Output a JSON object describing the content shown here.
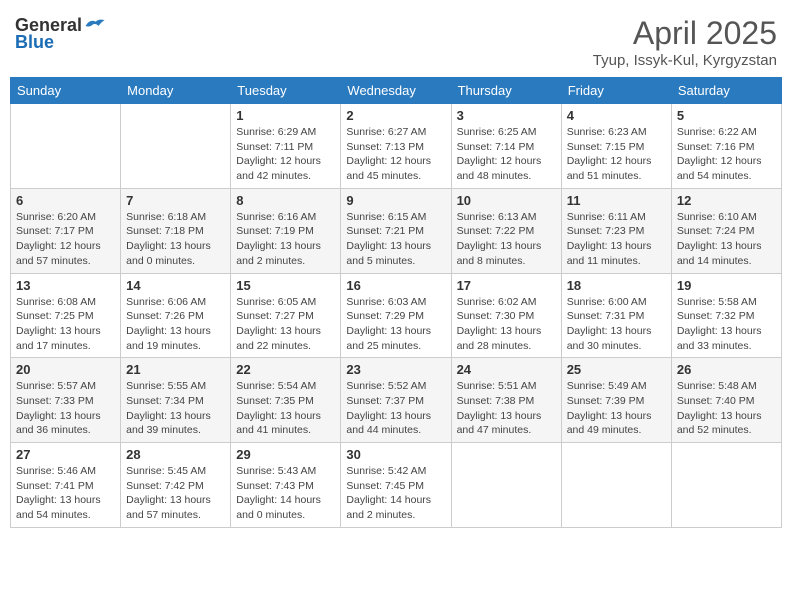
{
  "header": {
    "logo_general": "General",
    "logo_blue": "Blue",
    "title": "April 2025",
    "location": "Tyup, Issyk-Kul, Kyrgyzstan"
  },
  "weekdays": [
    "Sunday",
    "Monday",
    "Tuesday",
    "Wednesday",
    "Thursday",
    "Friday",
    "Saturday"
  ],
  "weeks": [
    [
      {
        "day": "",
        "info": ""
      },
      {
        "day": "",
        "info": ""
      },
      {
        "day": "1",
        "info": "Sunrise: 6:29 AM\nSunset: 7:11 PM\nDaylight: 12 hours\nand 42 minutes."
      },
      {
        "day": "2",
        "info": "Sunrise: 6:27 AM\nSunset: 7:13 PM\nDaylight: 12 hours\nand 45 minutes."
      },
      {
        "day": "3",
        "info": "Sunrise: 6:25 AM\nSunset: 7:14 PM\nDaylight: 12 hours\nand 48 minutes."
      },
      {
        "day": "4",
        "info": "Sunrise: 6:23 AM\nSunset: 7:15 PM\nDaylight: 12 hours\nand 51 minutes."
      },
      {
        "day": "5",
        "info": "Sunrise: 6:22 AM\nSunset: 7:16 PM\nDaylight: 12 hours\nand 54 minutes."
      }
    ],
    [
      {
        "day": "6",
        "info": "Sunrise: 6:20 AM\nSunset: 7:17 PM\nDaylight: 12 hours\nand 57 minutes."
      },
      {
        "day": "7",
        "info": "Sunrise: 6:18 AM\nSunset: 7:18 PM\nDaylight: 13 hours\nand 0 minutes."
      },
      {
        "day": "8",
        "info": "Sunrise: 6:16 AM\nSunset: 7:19 PM\nDaylight: 13 hours\nand 2 minutes."
      },
      {
        "day": "9",
        "info": "Sunrise: 6:15 AM\nSunset: 7:21 PM\nDaylight: 13 hours\nand 5 minutes."
      },
      {
        "day": "10",
        "info": "Sunrise: 6:13 AM\nSunset: 7:22 PM\nDaylight: 13 hours\nand 8 minutes."
      },
      {
        "day": "11",
        "info": "Sunrise: 6:11 AM\nSunset: 7:23 PM\nDaylight: 13 hours\nand 11 minutes."
      },
      {
        "day": "12",
        "info": "Sunrise: 6:10 AM\nSunset: 7:24 PM\nDaylight: 13 hours\nand 14 minutes."
      }
    ],
    [
      {
        "day": "13",
        "info": "Sunrise: 6:08 AM\nSunset: 7:25 PM\nDaylight: 13 hours\nand 17 minutes."
      },
      {
        "day": "14",
        "info": "Sunrise: 6:06 AM\nSunset: 7:26 PM\nDaylight: 13 hours\nand 19 minutes."
      },
      {
        "day": "15",
        "info": "Sunrise: 6:05 AM\nSunset: 7:27 PM\nDaylight: 13 hours\nand 22 minutes."
      },
      {
        "day": "16",
        "info": "Sunrise: 6:03 AM\nSunset: 7:29 PM\nDaylight: 13 hours\nand 25 minutes."
      },
      {
        "day": "17",
        "info": "Sunrise: 6:02 AM\nSunset: 7:30 PM\nDaylight: 13 hours\nand 28 minutes."
      },
      {
        "day": "18",
        "info": "Sunrise: 6:00 AM\nSunset: 7:31 PM\nDaylight: 13 hours\nand 30 minutes."
      },
      {
        "day": "19",
        "info": "Sunrise: 5:58 AM\nSunset: 7:32 PM\nDaylight: 13 hours\nand 33 minutes."
      }
    ],
    [
      {
        "day": "20",
        "info": "Sunrise: 5:57 AM\nSunset: 7:33 PM\nDaylight: 13 hours\nand 36 minutes."
      },
      {
        "day": "21",
        "info": "Sunrise: 5:55 AM\nSunset: 7:34 PM\nDaylight: 13 hours\nand 39 minutes."
      },
      {
        "day": "22",
        "info": "Sunrise: 5:54 AM\nSunset: 7:35 PM\nDaylight: 13 hours\nand 41 minutes."
      },
      {
        "day": "23",
        "info": "Sunrise: 5:52 AM\nSunset: 7:37 PM\nDaylight: 13 hours\nand 44 minutes."
      },
      {
        "day": "24",
        "info": "Sunrise: 5:51 AM\nSunset: 7:38 PM\nDaylight: 13 hours\nand 47 minutes."
      },
      {
        "day": "25",
        "info": "Sunrise: 5:49 AM\nSunset: 7:39 PM\nDaylight: 13 hours\nand 49 minutes."
      },
      {
        "day": "26",
        "info": "Sunrise: 5:48 AM\nSunset: 7:40 PM\nDaylight: 13 hours\nand 52 minutes."
      }
    ],
    [
      {
        "day": "27",
        "info": "Sunrise: 5:46 AM\nSunset: 7:41 PM\nDaylight: 13 hours\nand 54 minutes."
      },
      {
        "day": "28",
        "info": "Sunrise: 5:45 AM\nSunset: 7:42 PM\nDaylight: 13 hours\nand 57 minutes."
      },
      {
        "day": "29",
        "info": "Sunrise: 5:43 AM\nSunset: 7:43 PM\nDaylight: 14 hours\nand 0 minutes."
      },
      {
        "day": "30",
        "info": "Sunrise: 5:42 AM\nSunset: 7:45 PM\nDaylight: 14 hours\nand 2 minutes."
      },
      {
        "day": "",
        "info": ""
      },
      {
        "day": "",
        "info": ""
      },
      {
        "day": "",
        "info": ""
      }
    ]
  ]
}
